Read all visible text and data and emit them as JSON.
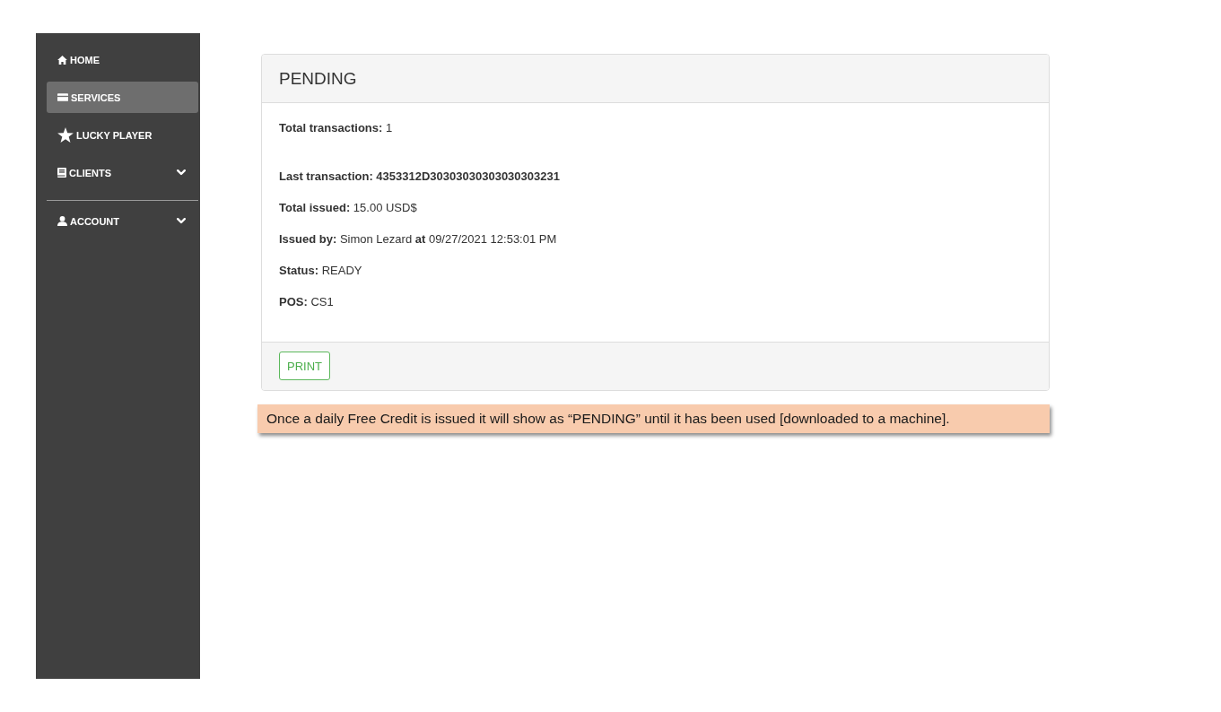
{
  "sidebar": {
    "groups": [
      {
        "items": [
          {
            "label": "HOME",
            "selected": false,
            "kind": "link"
          },
          {
            "label": "SERVICES",
            "selected": true,
            "kind": "link"
          },
          {
            "label": "LUCKY PLAYER",
            "selected": false,
            "kind": "link"
          },
          {
            "label": "CLIENTS",
            "selected": false,
            "kind": "submenu"
          }
        ]
      },
      {
        "items": [
          {
            "label": "ACCOUNT",
            "selected": false,
            "kind": "submenu"
          }
        ]
      }
    ]
  },
  "panel": {
    "title": "PENDING",
    "details": [
      {
        "text": "**Total transactions:** 1",
        "kind": "summary"
      },
      {
        "text": "Last transaction: 4353312D30303030303030303231",
        "kind": "strong"
      },
      {
        "text": "**Total issued:** 15.00 USD$",
        "kind": "field"
      },
      {
        "text": "**Issued by:** Simon Lezard **at** 09/27/2021 12:53:01 PM",
        "kind": "field"
      },
      {
        "text": "**Status:** READY",
        "kind": "field"
      },
      {
        "text": "**POS:** CS1",
        "kind": "field"
      }
    ],
    "buttons": [
      {
        "label": "PRINT"
      }
    ]
  },
  "note": {
    "text": "Once a daily Free Credit is issued it will show as “PENDING” until it has been used [downloaded to a machine]."
  }
}
